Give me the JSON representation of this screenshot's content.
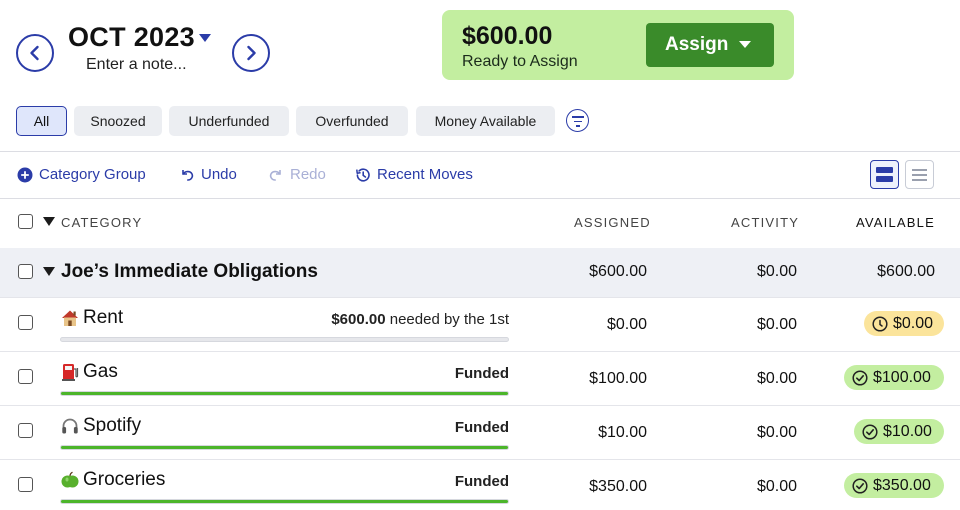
{
  "header": {
    "month": "OCT 2023",
    "note_placeholder": "Enter a note...",
    "ready_amount": "$600.00",
    "ready_label": "Ready to Assign",
    "assign_label": "Assign"
  },
  "filters": [
    "All",
    "Snoozed",
    "Underfunded",
    "Overfunded",
    "Money Available"
  ],
  "toolbar": {
    "category_group": "Category Group",
    "undo": "Undo",
    "redo": "Redo",
    "recent_moves": "Recent Moves"
  },
  "columns": {
    "category": "CATEGORY",
    "assigned": "ASSIGNED",
    "activity": "ACTIVITY",
    "available": "AVAILABLE"
  },
  "group": {
    "name": "Joe’s Immediate Obligations",
    "assigned": "$600.00",
    "activity": "$0.00",
    "available": "$600.00"
  },
  "categories": [
    {
      "icon": "house-icon",
      "name": "Rent",
      "goal_amount": "$600.00",
      "goal_text": " needed by the 1st",
      "progress": 0.0,
      "assigned": "$0.00",
      "activity": "$0.00",
      "available": "$0.00",
      "status": "underfunded"
    },
    {
      "icon": "fuel-pump-icon",
      "name": "Gas",
      "goal_amount": "",
      "goal_text": "Funded",
      "progress": 1.0,
      "assigned": "$100.00",
      "activity": "$0.00",
      "available": "$100.00",
      "status": "funded"
    },
    {
      "icon": "headphones-icon",
      "name": "Spotify",
      "goal_amount": "",
      "goal_text": "Funded",
      "progress": 1.0,
      "assigned": "$10.00",
      "activity": "$0.00",
      "available": "$10.00",
      "status": "funded"
    },
    {
      "icon": "apple-icon",
      "name": "Groceries",
      "goal_amount": "",
      "goal_text": "Funded",
      "progress": 1.0,
      "assigned": "$350.00",
      "activity": "$0.00",
      "available": "$350.00",
      "status": "funded"
    }
  ],
  "colors": {
    "accent": "#2b3ca8",
    "ready_bg": "#c3eea0",
    "assign_btn": "#3a8b2a",
    "funded_bar": "#4cb52a",
    "empty_bar": "#e6e7eb",
    "underfunded_pill": "#fbe49b"
  }
}
